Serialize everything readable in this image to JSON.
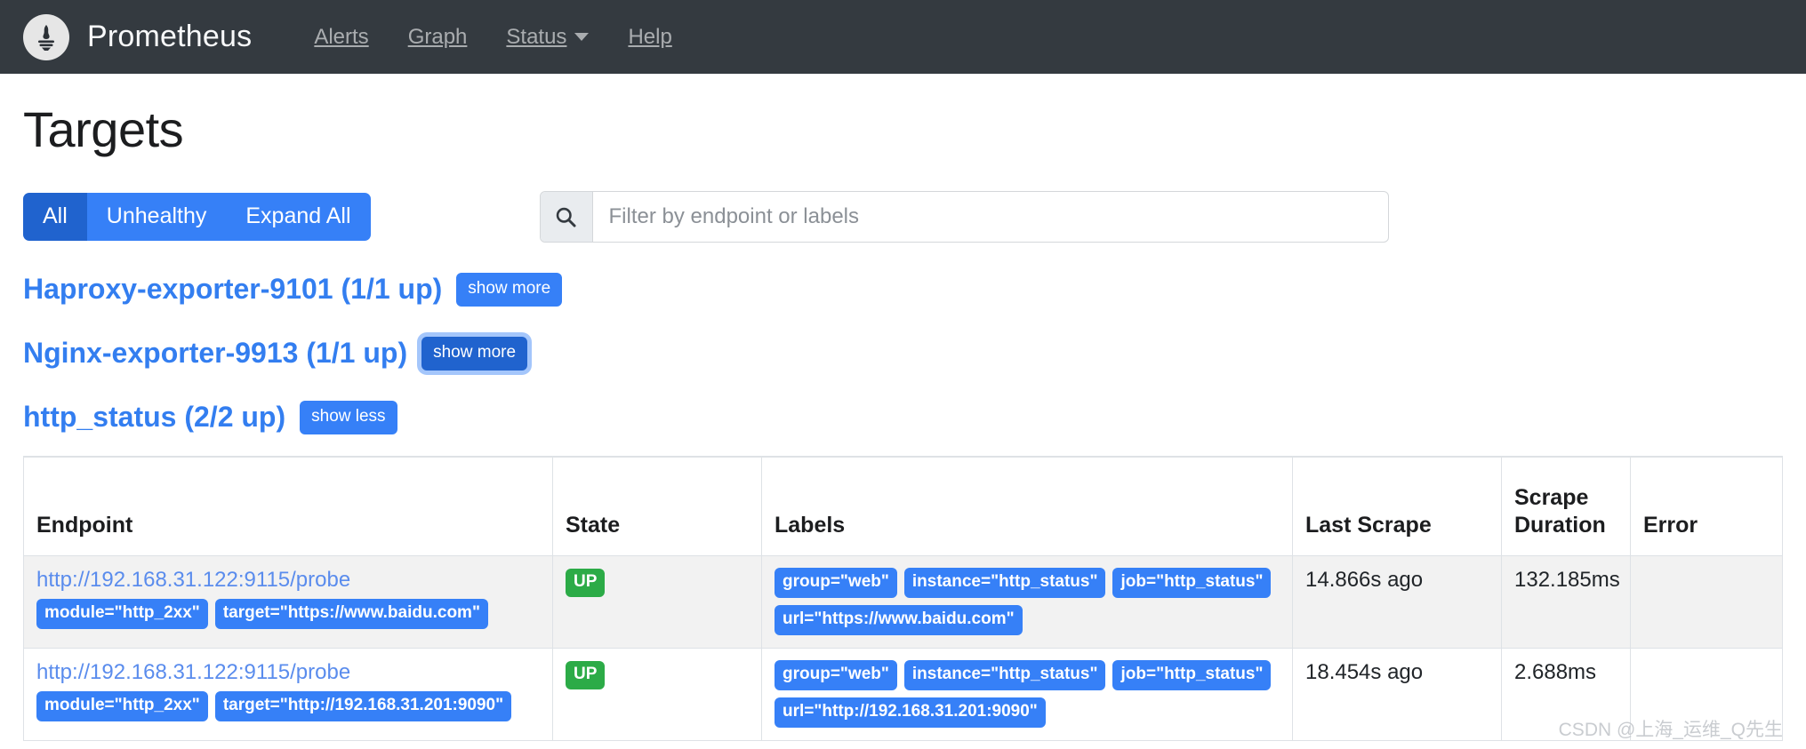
{
  "navbar": {
    "logo_icon": "prometheus-torch-logo",
    "brand": "Prometheus",
    "links": [
      {
        "label": "Alerts",
        "has_caret": false
      },
      {
        "label": "Graph",
        "has_caret": false
      },
      {
        "label": "Status",
        "has_caret": true
      },
      {
        "label": "Help",
        "has_caret": false
      }
    ],
    "background": "#343a40"
  },
  "page": {
    "title": "Targets"
  },
  "filters": {
    "buttons": [
      {
        "label": "All",
        "active": true
      },
      {
        "label": "Unhealthy",
        "active": false
      },
      {
        "label": "Expand All",
        "active": false
      }
    ],
    "search": {
      "icon": "search-icon",
      "placeholder": "Filter by endpoint or labels",
      "value": ""
    },
    "accent": "#3680f7",
    "accent_active": "#2063ce"
  },
  "jobs": [
    {
      "title": "Haproxy-exporter-9101 (1/1 up)",
      "toggle_label": "show more",
      "expanded": false,
      "focused": false
    },
    {
      "title": "Nginx-exporter-9913 (1/1 up)",
      "toggle_label": "show more",
      "expanded": false,
      "focused": true
    },
    {
      "title": "http_status (2/2 up)",
      "toggle_label": "show less",
      "expanded": true,
      "focused": false
    }
  ],
  "table": {
    "headers": [
      "Endpoint",
      "State",
      "Labels",
      "Last Scrape",
      "Scrape Duration",
      "Error"
    ],
    "rows": [
      {
        "endpoint": "http://192.168.31.122:9115/probe",
        "endpoint_badges": [
          "module=\"http_2xx\"",
          "target=\"https://www.baidu.com\""
        ],
        "state": "UP",
        "labels": [
          "group=\"web\"",
          "instance=\"http_status\"",
          "job=\"http_status\"",
          "url=\"https://www.baidu.com\""
        ],
        "last_scrape": "14.866s ago",
        "scrape_duration": "132.185ms",
        "error": ""
      },
      {
        "endpoint": "http://192.168.31.122:9115/probe",
        "endpoint_badges": [
          "module=\"http_2xx\"",
          "target=\"http://192.168.31.201:9090\""
        ],
        "state": "UP",
        "labels": [
          "group=\"web\"",
          "instance=\"http_status\"",
          "job=\"http_status\"",
          "url=\"http://192.168.31.201:9090\""
        ],
        "last_scrape": "18.454s ago",
        "scrape_duration": "2.688ms",
        "error": ""
      }
    ],
    "state_up_color": "#2cab47",
    "label_badge_color": "#3680f7"
  },
  "watermark": "CSDN @上海_运维_Q先生"
}
